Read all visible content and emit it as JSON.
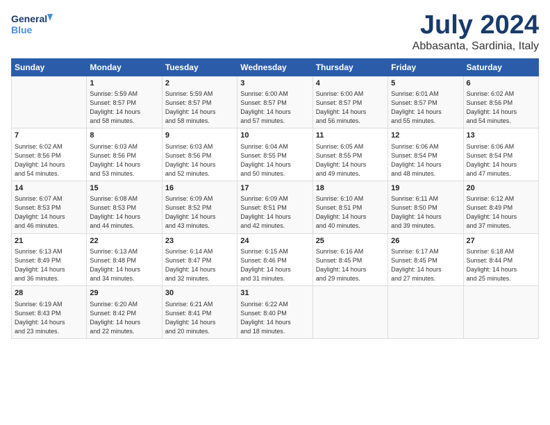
{
  "logo": {
    "line1": "General",
    "line2": "Blue"
  },
  "title": "July 2024",
  "subtitle": "Abbasanta, Sardinia, Italy",
  "header": {
    "days": [
      "Sunday",
      "Monday",
      "Tuesday",
      "Wednesday",
      "Thursday",
      "Friday",
      "Saturday"
    ]
  },
  "weeks": [
    {
      "cells": [
        {
          "num": "",
          "info": ""
        },
        {
          "num": "1",
          "info": "Sunrise: 5:59 AM\nSunset: 8:57 PM\nDaylight: 14 hours\nand 58 minutes."
        },
        {
          "num": "2",
          "info": "Sunrise: 5:59 AM\nSunset: 8:57 PM\nDaylight: 14 hours\nand 58 minutes."
        },
        {
          "num": "3",
          "info": "Sunrise: 6:00 AM\nSunset: 8:57 PM\nDaylight: 14 hours\nand 57 minutes."
        },
        {
          "num": "4",
          "info": "Sunrise: 6:00 AM\nSunset: 8:57 PM\nDaylight: 14 hours\nand 56 minutes."
        },
        {
          "num": "5",
          "info": "Sunrise: 6:01 AM\nSunset: 8:57 PM\nDaylight: 14 hours\nand 55 minutes."
        },
        {
          "num": "6",
          "info": "Sunrise: 6:02 AM\nSunset: 8:56 PM\nDaylight: 14 hours\nand 54 minutes."
        }
      ]
    },
    {
      "cells": [
        {
          "num": "7",
          "info": "Sunrise: 6:02 AM\nSunset: 8:56 PM\nDaylight: 14 hours\nand 54 minutes."
        },
        {
          "num": "8",
          "info": "Sunrise: 6:03 AM\nSunset: 8:56 PM\nDaylight: 14 hours\nand 53 minutes."
        },
        {
          "num": "9",
          "info": "Sunrise: 6:03 AM\nSunset: 8:56 PM\nDaylight: 14 hours\nand 52 minutes."
        },
        {
          "num": "10",
          "info": "Sunrise: 6:04 AM\nSunset: 8:55 PM\nDaylight: 14 hours\nand 50 minutes."
        },
        {
          "num": "11",
          "info": "Sunrise: 6:05 AM\nSunset: 8:55 PM\nDaylight: 14 hours\nand 49 minutes."
        },
        {
          "num": "12",
          "info": "Sunrise: 6:06 AM\nSunset: 8:54 PM\nDaylight: 14 hours\nand 48 minutes."
        },
        {
          "num": "13",
          "info": "Sunrise: 6:06 AM\nSunset: 8:54 PM\nDaylight: 14 hours\nand 47 minutes."
        }
      ]
    },
    {
      "cells": [
        {
          "num": "14",
          "info": "Sunrise: 6:07 AM\nSunset: 8:53 PM\nDaylight: 14 hours\nand 46 minutes."
        },
        {
          "num": "15",
          "info": "Sunrise: 6:08 AM\nSunset: 8:53 PM\nDaylight: 14 hours\nand 44 minutes."
        },
        {
          "num": "16",
          "info": "Sunrise: 6:09 AM\nSunset: 8:52 PM\nDaylight: 14 hours\nand 43 minutes."
        },
        {
          "num": "17",
          "info": "Sunrise: 6:09 AM\nSunset: 8:51 PM\nDaylight: 14 hours\nand 42 minutes."
        },
        {
          "num": "18",
          "info": "Sunrise: 6:10 AM\nSunset: 8:51 PM\nDaylight: 14 hours\nand 40 minutes."
        },
        {
          "num": "19",
          "info": "Sunrise: 6:11 AM\nSunset: 8:50 PM\nDaylight: 14 hours\nand 39 minutes."
        },
        {
          "num": "20",
          "info": "Sunrise: 6:12 AM\nSunset: 8:49 PM\nDaylight: 14 hours\nand 37 minutes."
        }
      ]
    },
    {
      "cells": [
        {
          "num": "21",
          "info": "Sunrise: 6:13 AM\nSunset: 8:49 PM\nDaylight: 14 hours\nand 36 minutes."
        },
        {
          "num": "22",
          "info": "Sunrise: 6:13 AM\nSunset: 8:48 PM\nDaylight: 14 hours\nand 34 minutes."
        },
        {
          "num": "23",
          "info": "Sunrise: 6:14 AM\nSunset: 8:47 PM\nDaylight: 14 hours\nand 32 minutes."
        },
        {
          "num": "24",
          "info": "Sunrise: 6:15 AM\nSunset: 8:46 PM\nDaylight: 14 hours\nand 31 minutes."
        },
        {
          "num": "25",
          "info": "Sunrise: 6:16 AM\nSunset: 8:45 PM\nDaylight: 14 hours\nand 29 minutes."
        },
        {
          "num": "26",
          "info": "Sunrise: 6:17 AM\nSunset: 8:45 PM\nDaylight: 14 hours\nand 27 minutes."
        },
        {
          "num": "27",
          "info": "Sunrise: 6:18 AM\nSunset: 8:44 PM\nDaylight: 14 hours\nand 25 minutes."
        }
      ]
    },
    {
      "cells": [
        {
          "num": "28",
          "info": "Sunrise: 6:19 AM\nSunset: 8:43 PM\nDaylight: 14 hours\nand 23 minutes."
        },
        {
          "num": "29",
          "info": "Sunrise: 6:20 AM\nSunset: 8:42 PM\nDaylight: 14 hours\nand 22 minutes."
        },
        {
          "num": "30",
          "info": "Sunrise: 6:21 AM\nSunset: 8:41 PM\nDaylight: 14 hours\nand 20 minutes."
        },
        {
          "num": "31",
          "info": "Sunrise: 6:22 AM\nSunset: 8:40 PM\nDaylight: 14 hours\nand 18 minutes."
        },
        {
          "num": "",
          "info": ""
        },
        {
          "num": "",
          "info": ""
        },
        {
          "num": "",
          "info": ""
        }
      ]
    }
  ]
}
